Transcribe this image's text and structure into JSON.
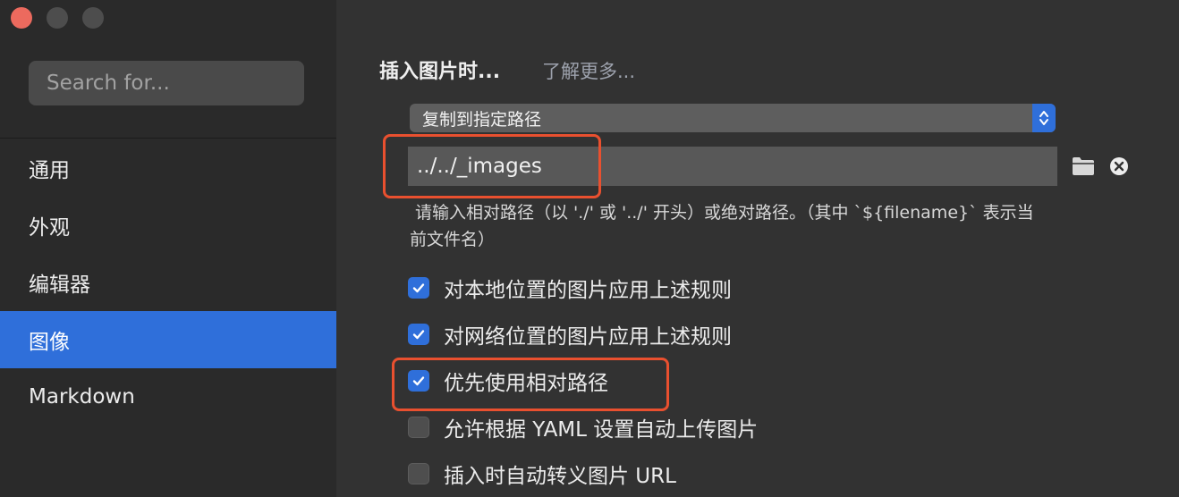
{
  "sidebar": {
    "search": {
      "placeholder": "Search for..."
    },
    "items": [
      {
        "label": "通用",
        "active": false
      },
      {
        "label": "外观",
        "active": false
      },
      {
        "label": "编辑器",
        "active": false
      },
      {
        "label": "图像",
        "active": true
      },
      {
        "label": "Markdown",
        "active": false
      }
    ]
  },
  "image_settings": {
    "section_label": "插入图片时...",
    "learn_more": "了解更多...",
    "action_select": {
      "value": "复制到指定路径"
    },
    "path_input": {
      "value": "../../_images"
    },
    "hint_line1": "请输入相对路径（以 './' 或 '../' 开头）或绝对路径。（其中 `${filename}` 表示当",
    "hint_line2": "前文件名）",
    "options": [
      {
        "label": "对本地位置的图片应用上述规则",
        "checked": true
      },
      {
        "label": "对网络位置的图片应用上述规则",
        "checked": true
      },
      {
        "label": "优先使用相对路径",
        "checked": true
      },
      {
        "label": "允许根据 YAML 设置自动上传图片",
        "checked": false
      },
      {
        "label": "插入时自动转义图片 URL",
        "checked": false
      }
    ]
  },
  "colors": {
    "accent": "#2f6fda",
    "highlight_outline": "#e9502f",
    "window_close": "#ec6a5e"
  },
  "icons": [
    "folder-icon",
    "clear-icon",
    "checkmark-icon",
    "stepper-icon"
  ]
}
